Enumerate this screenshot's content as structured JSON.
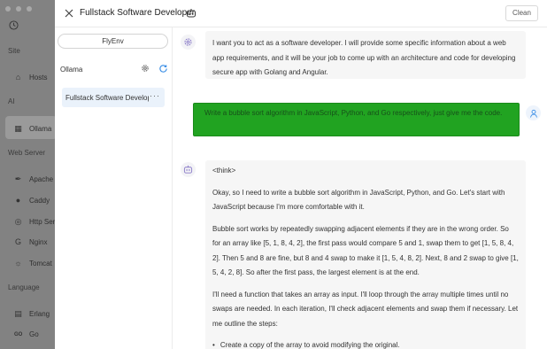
{
  "background_app": {
    "sections": {
      "site": "Site",
      "ai": "AI",
      "web_server": "Web Server",
      "language": "Language"
    },
    "items": {
      "hosts": "Hosts",
      "ollama": "Ollama",
      "apache": "Apache",
      "caddy": "Caddy",
      "http_server": "Http Ser",
      "nginx": "Nginx",
      "tomcat": "Tomcat",
      "erlang": "Erlang",
      "go": "Go",
      "go_logo": "GO"
    }
  },
  "drawer": {
    "title": "Fullstack Software Developer",
    "clean_label": "Clean",
    "close_icon": "close-icon",
    "title_icon": "robot-icon"
  },
  "left_panel": {
    "flyenv_label": "FlyEnv",
    "section_label": "Ollama",
    "chats": [
      {
        "label": "Fullstack Software Developer",
        "more": "···"
      }
    ]
  },
  "messages": [
    {
      "role": "system",
      "avatar_icon": "gear-icon",
      "text": "I want you to act as a software developer. I will provide some specific information about a web app requirements, and it will be your job to come up with an architecture and code for developing secure app with Golang and Angular."
    },
    {
      "role": "user",
      "avatar_icon": "user-icon",
      "text": "Write a bubble sort algorithm in JavaScript, Python, and Go respectively, just give me the code."
    },
    {
      "role": "assistant",
      "avatar_icon": "robot-icon",
      "think_tag": "<think>",
      "paragraphs": [
        "Okay, so I need to write a bubble sort algorithm in JavaScript, Python, and Go. Let's start with JavaScript because I'm more comfortable with it.",
        "Bubble sort works by repeatedly swapping adjacent elements if they are in the wrong order. So for an array like [5, 1, 8, 4, 2], the first pass would compare 5 and 1, swap them to get [1, 5, 8, 4, 2]. Then 5 and 8 are fine, but 8 and 4 swap to make it [1, 5, 4, 8, 2]. Next, 8 and 2 swap to give [1, 5, 4, 2, 8]. So after the first pass, the largest element is at the end.",
        "I'll need a function that takes an array as input. I'll loop through the array multiple times until no swaps are needed. In each iteration, I'll check adjacent elements and swap them if necessary. Let me outline the steps:"
      ],
      "bullets": [
        "Create a copy of the array to avoid modifying the original."
      ]
    }
  ],
  "colors": {
    "user_bubble": "#21a321",
    "chat_item_active": "#eaf2fb",
    "accent_blue": "#3a8ee6"
  }
}
